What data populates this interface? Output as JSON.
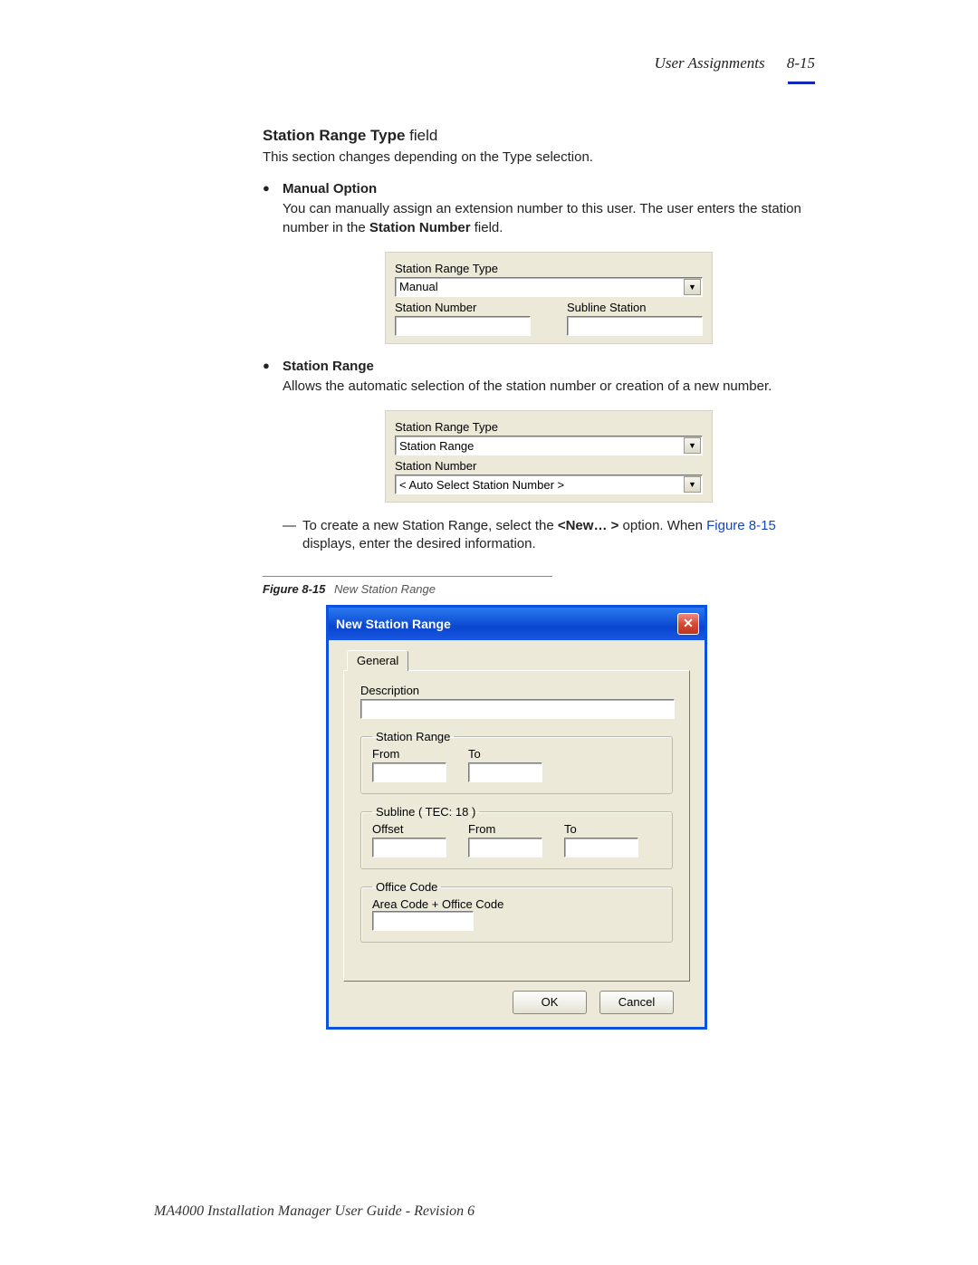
{
  "header": {
    "section": "User Assignments",
    "page_num": "8-15"
  },
  "heading": {
    "bold": "Station Range Type",
    "normal": " field"
  },
  "intro": "This section changes depending on the Type selection.",
  "manual": {
    "title": "Manual Option",
    "text_before": "You can manually assign an extension number to this user. The user enters the station number in the ",
    "field_name": "Station Number",
    "text_after": " field.",
    "form": {
      "range_type_label": "Station Range Type",
      "range_type_value": "Manual",
      "station_number_label": "Station Number",
      "subline_label": "Subline Station"
    }
  },
  "range": {
    "title": "Station Range",
    "text": "Allows the automatic selection of the station number or creation of a new number.",
    "form": {
      "range_type_label": "Station Range Type",
      "range_type_value": "Station Range",
      "station_number_label": "Station Number",
      "station_number_value": "< Auto Select Station Number >"
    },
    "note_before": "To create a new Station Range, select the ",
    "note_bold": "<New… >",
    "note_mid": " option. When ",
    "note_link": "Figure 8-15",
    "note_after": " displays, enter the desired information."
  },
  "figure": {
    "num": "Figure 8-15",
    "title": "New Station Range"
  },
  "dialog": {
    "title": "New Station Range",
    "tab": "General",
    "description_label": "Description",
    "station_range": {
      "legend": "Station Range",
      "from": "From",
      "to": "To"
    },
    "subline": {
      "legend": "Subline ( TEC: 18 )",
      "offset": "Offset",
      "from": "From",
      "to": "To"
    },
    "office": {
      "legend": "Office Code",
      "label": "Area Code + Office Code"
    },
    "buttons": {
      "ok": "OK",
      "cancel": "Cancel"
    }
  },
  "footer": "MA4000 Installation Manager User Guide - Revision 6"
}
